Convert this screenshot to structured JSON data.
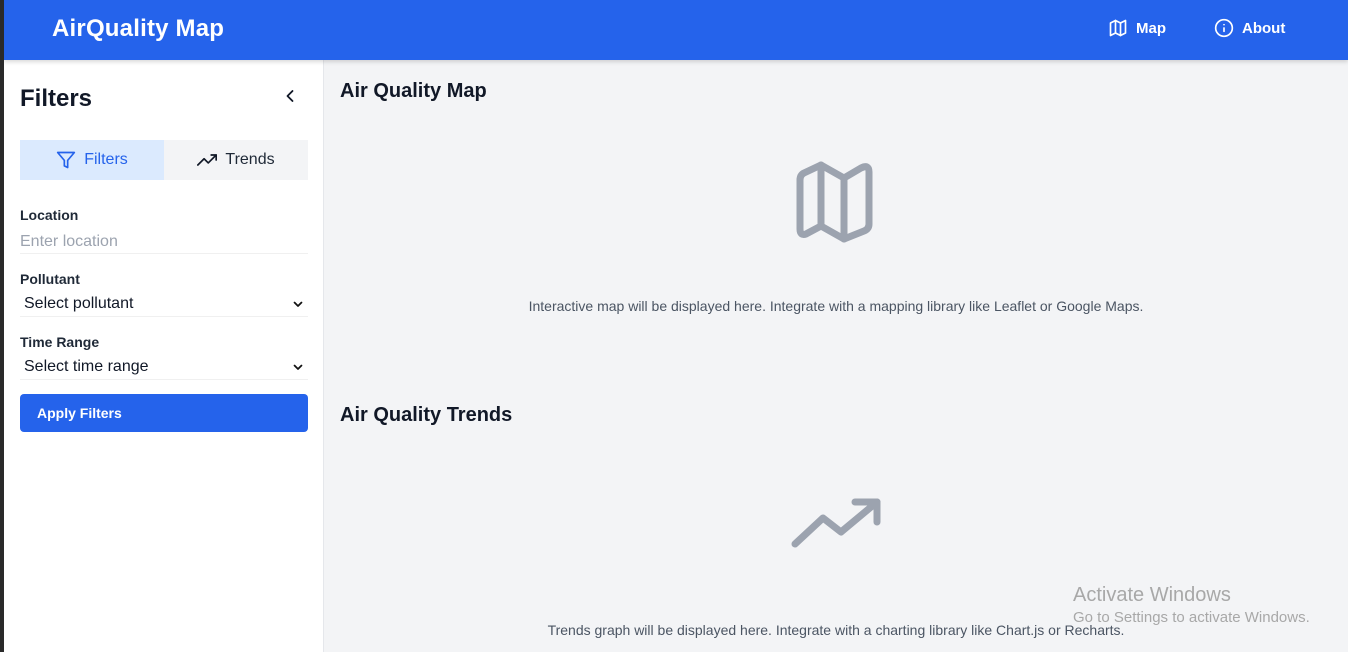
{
  "header": {
    "brand": "AirQuality Map",
    "nav": [
      {
        "label": "Map",
        "icon": "map-icon"
      },
      {
        "label": "About",
        "icon": "info-icon"
      }
    ],
    "bg_color": "#2563eb"
  },
  "sidebar": {
    "title": "Filters",
    "tabs": [
      {
        "label": "Filters",
        "icon": "filter-icon",
        "active": true
      },
      {
        "label": "Trends",
        "icon": "trending-up-icon",
        "active": false
      }
    ],
    "location": {
      "label": "Location",
      "placeholder": "Enter location",
      "value": ""
    },
    "pollutant": {
      "label": "Pollutant",
      "value": "Select pollutant"
    },
    "time_range": {
      "label": "Time Range",
      "value": "Select time range"
    },
    "apply_label": "Apply Filters"
  },
  "main": {
    "map_section": {
      "title": "Air Quality Map",
      "icon": "map-icon",
      "placeholder": "Interactive map will be displayed here. Integrate with a mapping library like Leaflet or Google Maps."
    },
    "trends_section": {
      "title": "Air Quality Trends",
      "icon": "trending-up-icon",
      "placeholder": "Trends graph will be displayed here. Integrate with a charting library like Chart.js or Recharts."
    }
  },
  "watermark": {
    "title": "Activate Windows",
    "subtitle": "Go to Settings to activate Windows."
  }
}
